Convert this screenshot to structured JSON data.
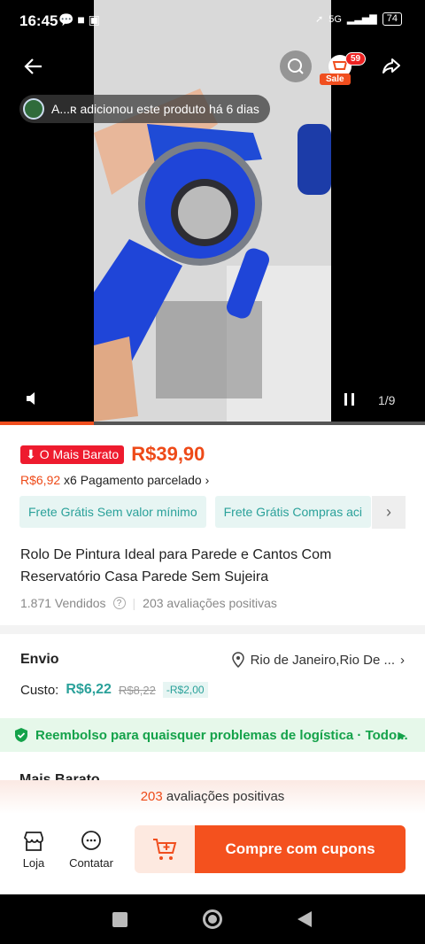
{
  "status": {
    "time": "16:45",
    "network": "5G",
    "battery": "74"
  },
  "header": {
    "cart_count": "59",
    "sale_label": "Sale"
  },
  "media": {
    "added_text": "A...ʀ adicionou este produto há 6 dias",
    "counter": "1/9",
    "progress": 0.22
  },
  "price": {
    "cheap_label": "O Mais Barato",
    "value": "R$39,90",
    "installment_amount": "R$6,92",
    "installment_text": "x6 Pagamento parcelado"
  },
  "chips": [
    "Frete Grátis Sem valor mínimo",
    "Frete Grátis Compras aci"
  ],
  "product": {
    "title": "Rolo De Pintura Ideal para Parede e Cantos Com Reservatório Casa Parede Sem Sujeira",
    "sold": "1.871 Vendidos",
    "reviews": "203 avaliações positivas"
  },
  "shipping": {
    "label": "Envio",
    "location": "Rio de Janeiro,Rio De ...",
    "cost_label": "Custo:",
    "cost": "R$6,22",
    "old_cost": "R$8,22",
    "discount": "-R$2,00"
  },
  "refund": {
    "text": "Reembolso para quaisquer problemas de logística · Todo..."
  },
  "section_peek": "Mais Barato",
  "review_bar": {
    "count": "203",
    "text": "avaliações positivas"
  },
  "bottom": {
    "store": "Loja",
    "chat": "Contatar",
    "buy": "Compre com cupons"
  }
}
